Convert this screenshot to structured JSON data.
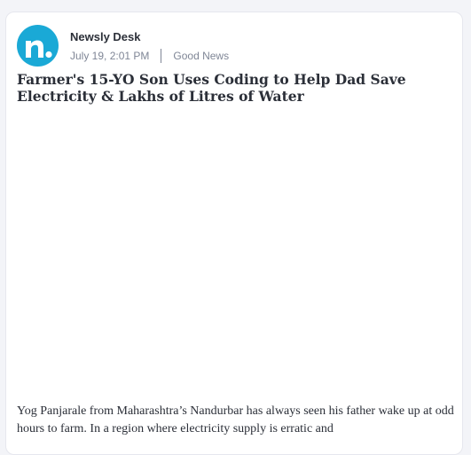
{
  "post": {
    "author": "Newsly Desk",
    "timestamp": "July 19, 2:01 PM",
    "category": "Good News",
    "title": "Farmer's 15-YO Son Uses Coding to Help Dad Save Electricity & Lakhs of Litres of Water",
    "body": "Yog Panjarale from Maharashtra’s Nandurbar has always seen his father wake up at odd hours to farm. In a region where electricity supply is erratic and"
  },
  "avatar": {
    "icon": "newsly-logo-icon",
    "color": "#1aa9d6"
  },
  "colors": {
    "text": "#2b2f38",
    "muted": "#7f8696",
    "brand": "#1aa9d6"
  }
}
